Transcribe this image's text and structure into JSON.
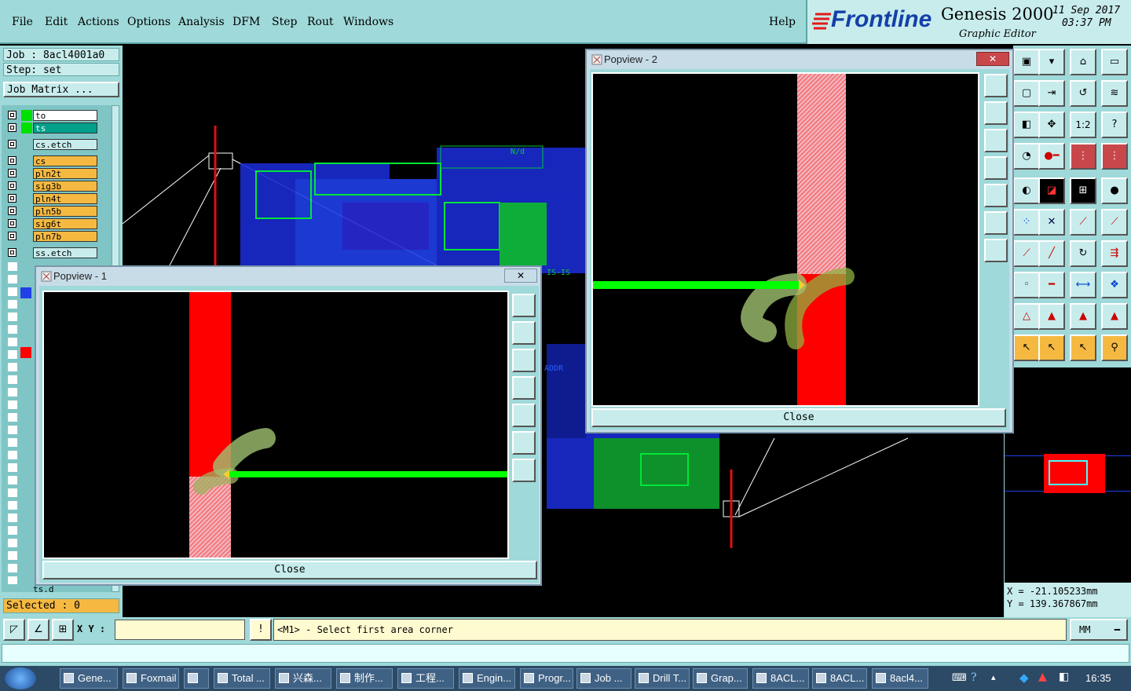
{
  "menu": {
    "items": [
      "File",
      "Edit",
      "Actions",
      "Options",
      "Analysis",
      "DFM",
      "Step",
      "Rout",
      "Windows"
    ],
    "help": "Help"
  },
  "brand": {
    "logo": "Frontline",
    "product": "Genesis 2000",
    "subtitle": "Graphic Editor",
    "date": "11 Sep 2017",
    "time": "03:37 PM"
  },
  "left": {
    "job": "Job : 8acl4001a0",
    "step": "Step: set",
    "job_matrix": "Job Matrix ...",
    "layers": [
      {
        "name": "to",
        "color": "#00e000",
        "bg": "#ffffff"
      },
      {
        "name": "ts",
        "color": "#00e000",
        "bg": "#00a08a"
      },
      {
        "name": "cs.etch",
        "color": "",
        "bg": "#c8ecec"
      },
      {
        "name": "cs",
        "color": "",
        "bg": "#f5b942"
      },
      {
        "name": "pln2t",
        "color": "",
        "bg": "#f5b942"
      },
      {
        "name": "sig3b",
        "color": "",
        "bg": "#f5b942"
      },
      {
        "name": "pln4t",
        "color": "",
        "bg": "#f5b942"
      },
      {
        "name": "pln5b",
        "color": "",
        "bg": "#f5b942"
      },
      {
        "name": "sig6t",
        "color": "",
        "bg": "#f5b942"
      },
      {
        "name": "pln7b",
        "color": "",
        "bg": "#f5b942"
      },
      {
        "name": "ss.etch",
        "color": "",
        "bg": "#c8ecec"
      }
    ],
    "bottom_layer": "ts.d",
    "selected": "Selected : 0"
  },
  "popup1": {
    "title": "Popview - 1",
    "close": "Close"
  },
  "popup2": {
    "title": "Popview - 2",
    "close": "Close"
  },
  "coords": {
    "x": "X = -21.105233mm",
    "y": "Y = 139.367867mm"
  },
  "status": {
    "xy_label": "X Y :",
    "prompt": "<M1> - Select first area corner",
    "units": "MM"
  },
  "taskbar": {
    "tasks": [
      "Gene...",
      "Foxmail",
      "",
      "Total ...",
      "兴森...",
      "制作...",
      "工程...",
      "Engin...",
      "Progr...",
      "Job ...",
      "Drill T...",
      "Grap...",
      "8ACL...",
      "8ACL...",
      "8acl4..."
    ],
    "clock": "16:35"
  },
  "canvas_labels": {
    "nd": "N/d",
    "addr": "ADDR",
    "is": "IS-IS"
  },
  "colors": {
    "panel": "#9fd9d9",
    "layer_orange": "#f5b942",
    "trace_green": "#00ff00",
    "pad_red": "#ff0000"
  }
}
